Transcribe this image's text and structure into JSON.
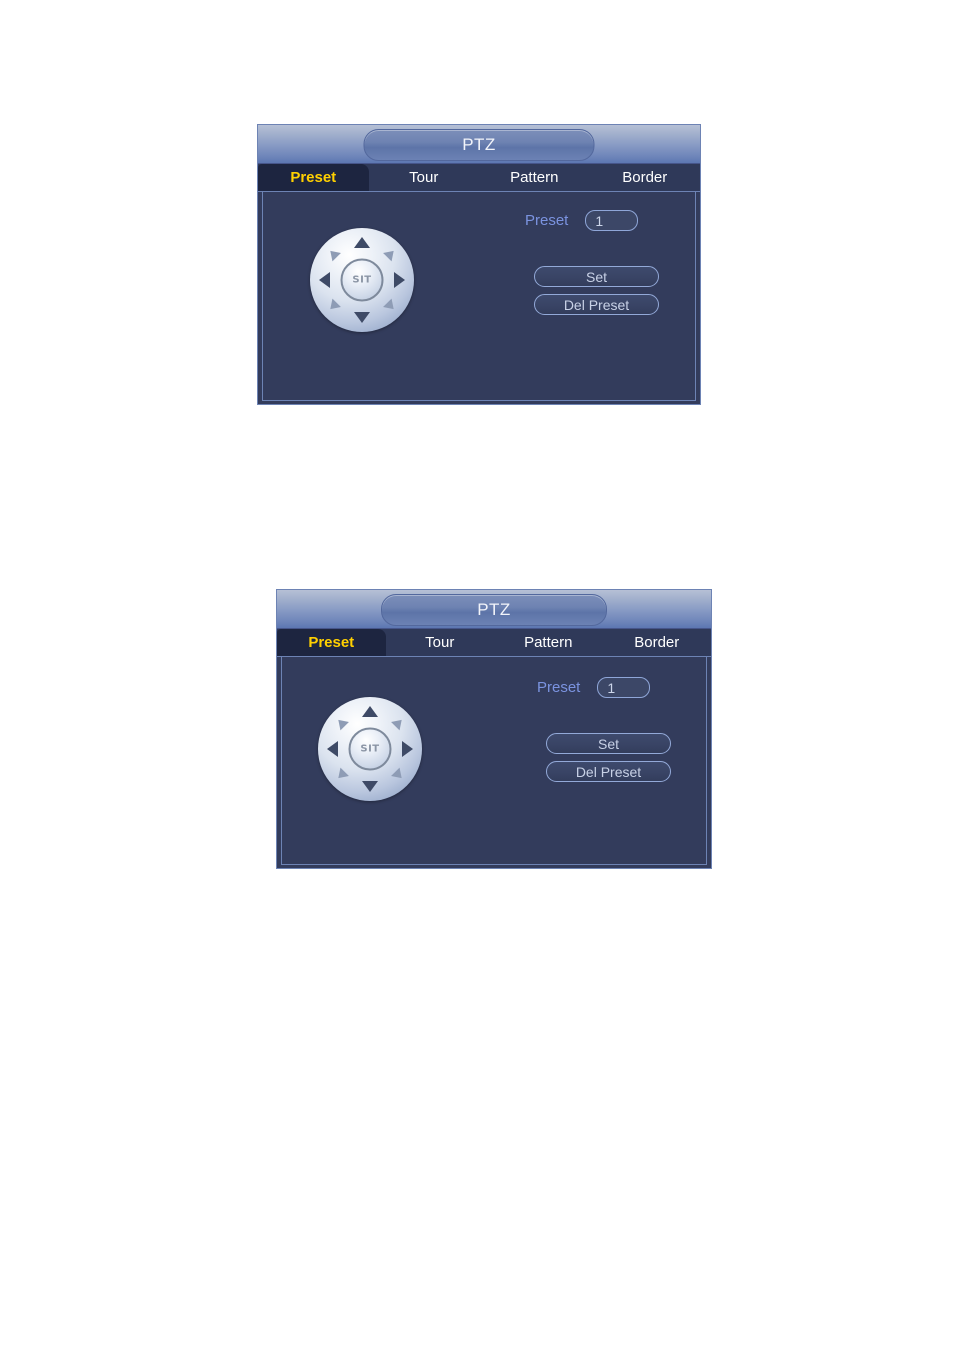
{
  "page": {
    "background": "#ffffff"
  },
  "colors": {
    "dialog_body": "#333c5c",
    "dialog_border": "#6d83b4",
    "tab_active_bg": "#1d2540",
    "tab_active_text": "#ffd000",
    "tab_text": "#ffffff",
    "label_blue": "#7b93e0",
    "titlebar_gradient_top": "#b6c0d6",
    "titlebar_gradient_bottom": "#5c77b2"
  },
  "panels": [
    {
      "id": "ptz-dialog-upper",
      "title": "PTZ",
      "tabs": [
        {
          "label": "Preset",
          "active": true
        },
        {
          "label": "Tour",
          "active": false
        },
        {
          "label": "Pattern",
          "active": false
        },
        {
          "label": "Border",
          "active": false
        }
      ],
      "joystick": {
        "center_label": "SIT",
        "directions": [
          "up-arrow-icon",
          "down-arrow-icon",
          "left-arrow-icon",
          "right-arrow-icon",
          "up-left-arrow-icon",
          "up-right-arrow-icon",
          "down-left-arrow-icon",
          "down-right-arrow-icon"
        ]
      },
      "form": {
        "preset_label": "Preset",
        "preset_value": "1",
        "preset_placeholder": "1",
        "set_button": "Set",
        "del_button": "Del Preset"
      }
    },
    {
      "id": "ptz-dialog-lower",
      "title": "PTZ",
      "tabs": [
        {
          "label": "Preset",
          "active": true
        },
        {
          "label": "Tour",
          "active": false
        },
        {
          "label": "Pattern",
          "active": false
        },
        {
          "label": "Border",
          "active": false
        }
      ],
      "joystick": {
        "center_label": "SIT",
        "directions": [
          "up-arrow-icon",
          "down-arrow-icon",
          "left-arrow-icon",
          "right-arrow-icon",
          "up-left-arrow-icon",
          "up-right-arrow-icon",
          "down-left-arrow-icon",
          "down-right-arrow-icon"
        ]
      },
      "form": {
        "preset_label": "Preset",
        "preset_value": "1",
        "preset_placeholder": "1",
        "set_button": "Set",
        "del_button": "Del Preset"
      }
    }
  ]
}
